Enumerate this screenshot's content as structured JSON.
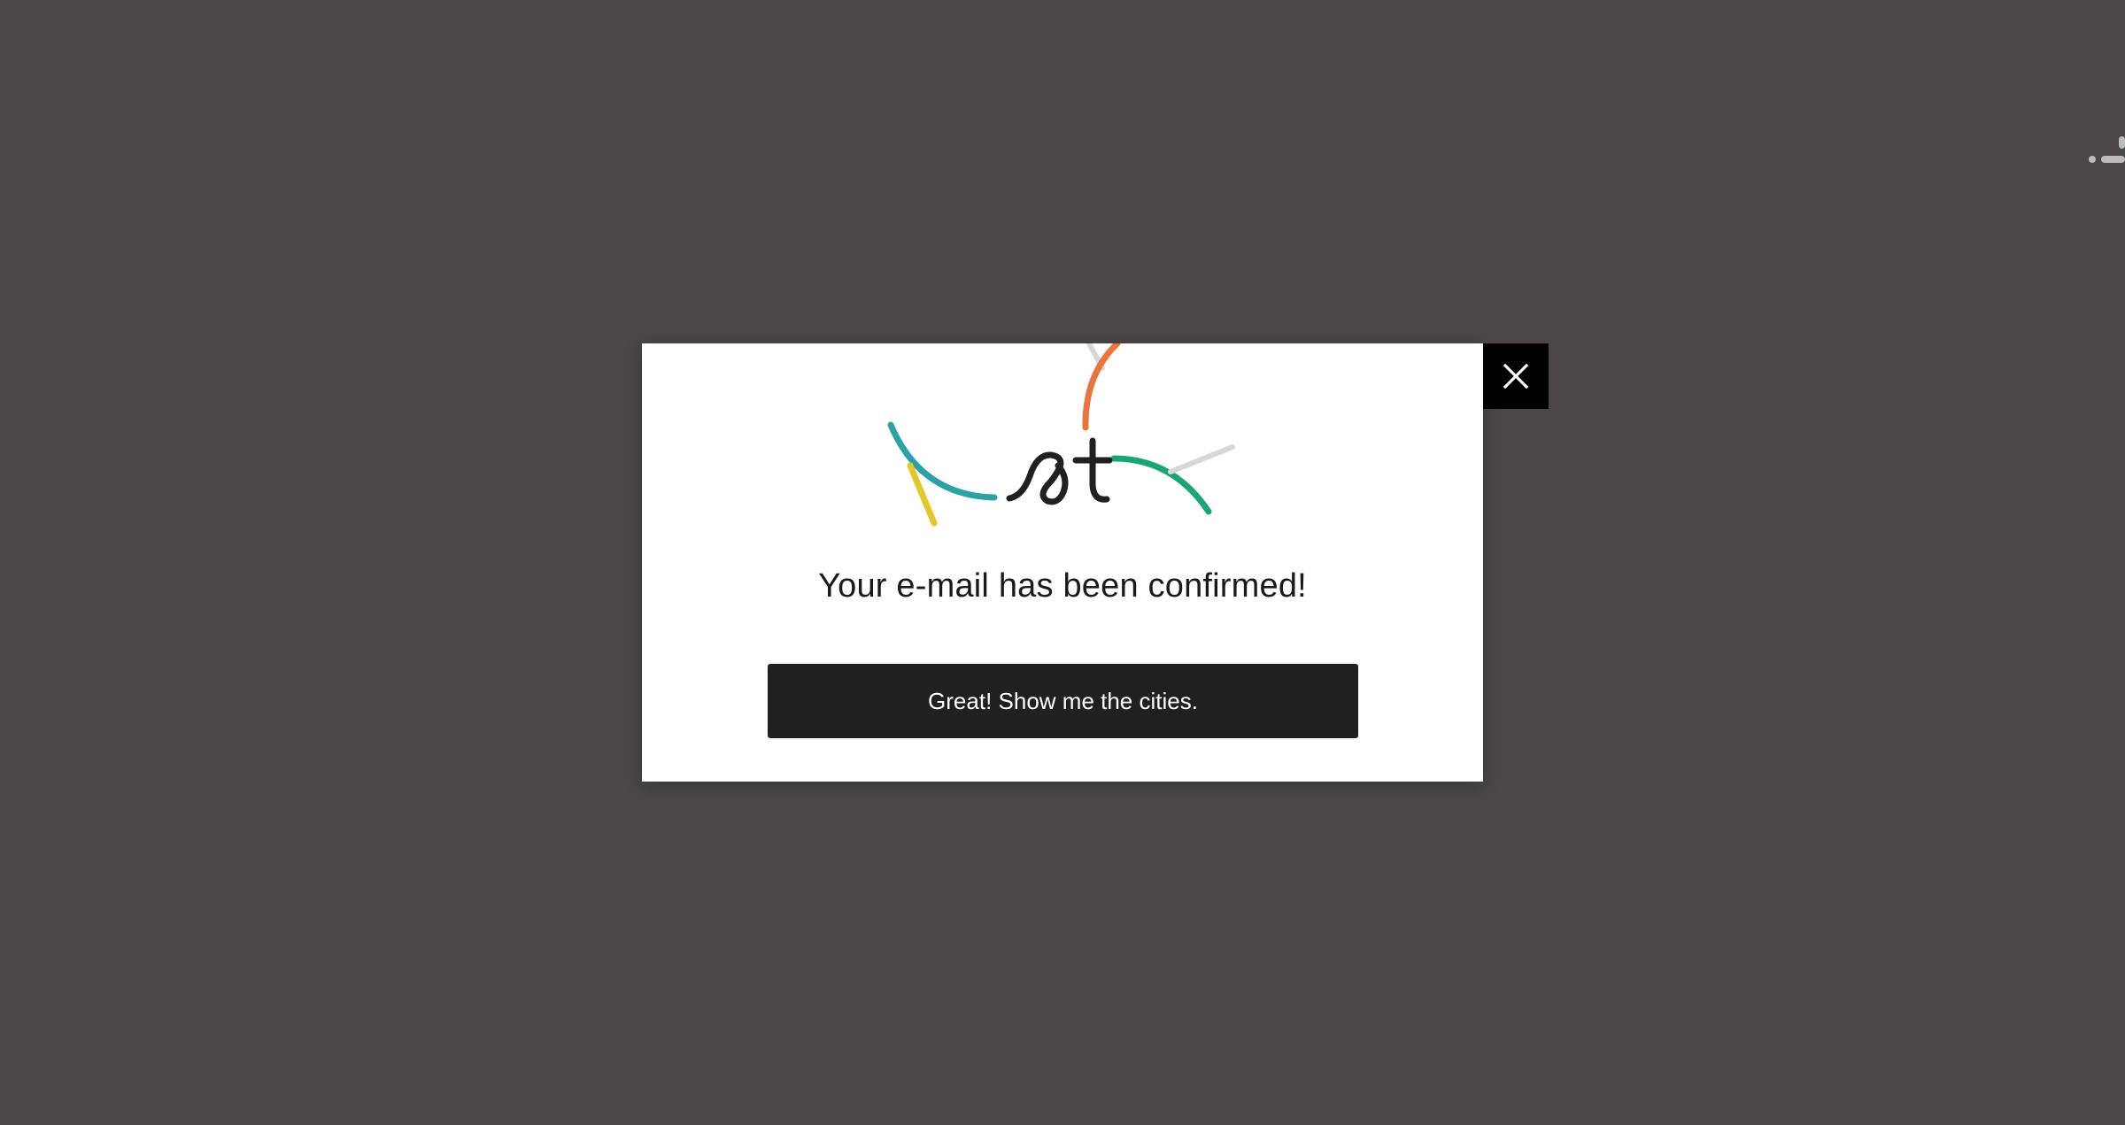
{
  "colors": {
    "backdrop": "#4b4747",
    "modal_background": "#ffffff",
    "text_primary": "#1a1a1a",
    "button_background": "#221f20",
    "button_text": "#ffffff",
    "close_background": "#000000",
    "close_icon": "#ffffff",
    "logo_teal": "#2ba3a6",
    "logo_yellow": "#e6c72a",
    "logo_orange": "#e9743d",
    "logo_green": "#1aa574",
    "logo_grey": "#d7d7d7",
    "logo_letters": "#221f20",
    "spinner": "#bcbcbc"
  },
  "modal": {
    "logo": {
      "icon": "brand-logo-icon",
      "letters": "st"
    },
    "title": "Your e-mail has been confirmed!",
    "cta_label": "Great! Show me the cities.",
    "close_icon": "close-icon"
  },
  "background": {
    "corner_icon": "loading-spinner-icon"
  }
}
